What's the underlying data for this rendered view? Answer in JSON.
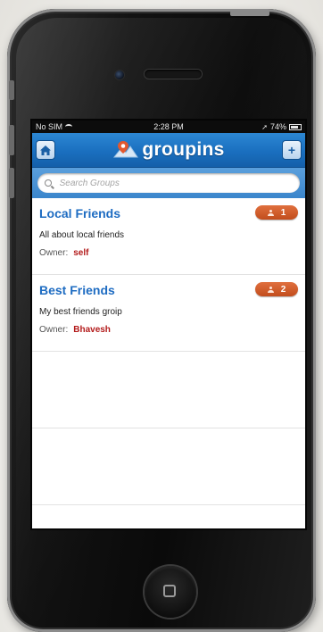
{
  "statusbar": {
    "carrier": "No SIM",
    "time": "2:28 PM",
    "battery": "74%"
  },
  "navbar": {
    "brand": "groupins",
    "home_icon": "home-icon",
    "add_icon": "add-icon",
    "add_symbol": "+",
    "home_symbol": "⌂"
  },
  "search": {
    "placeholder": "Search Groups"
  },
  "groups": [
    {
      "title": "Local Friends",
      "description": "All about local friends",
      "owner_label": "Owner:",
      "owner": "self",
      "count": "1"
    },
    {
      "title": "Best Friends",
      "description": "My best friends groip",
      "owner_label": "Owner:",
      "owner": "Bhavesh",
      "count": "2"
    }
  ],
  "colors": {
    "navbar": "#1a6fbf",
    "title": "#1e6cc2",
    "owner": "#b31b1b",
    "badge": "#c24d1d"
  }
}
